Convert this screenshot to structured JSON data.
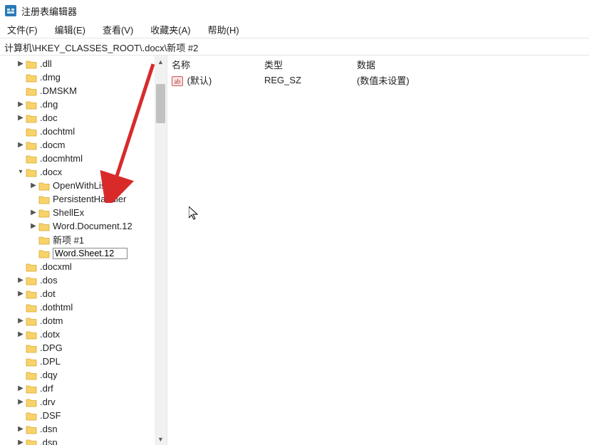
{
  "window": {
    "title": "注册表编辑器"
  },
  "menu": {
    "file": "文件(F)",
    "edit": "编辑(E)",
    "view": "查看(V)",
    "favorites": "收藏夹(A)",
    "help": "帮助(H)"
  },
  "address": "计算机\\HKEY_CLASSES_ROOT\\.docx\\新项 #2",
  "tree": [
    {
      "indent": 1,
      "exp": ">",
      "label": ".dll"
    },
    {
      "indent": 1,
      "exp": "",
      "label": ".dmg"
    },
    {
      "indent": 1,
      "exp": "",
      "label": ".DMSKM"
    },
    {
      "indent": 1,
      "exp": ">",
      "label": ".dng"
    },
    {
      "indent": 1,
      "exp": ">",
      "label": ".doc"
    },
    {
      "indent": 1,
      "exp": "",
      "label": ".dochtml"
    },
    {
      "indent": 1,
      "exp": ">",
      "label": ".docm"
    },
    {
      "indent": 1,
      "exp": "",
      "label": ".docmhtml"
    },
    {
      "indent": 1,
      "exp": "v",
      "label": ".docx"
    },
    {
      "indent": 2,
      "exp": ">",
      "label": "OpenWithList"
    },
    {
      "indent": 2,
      "exp": "",
      "label": "PersistentHandler"
    },
    {
      "indent": 2,
      "exp": ">",
      "label": "ShellEx"
    },
    {
      "indent": 2,
      "exp": ">",
      "label": "Word.Document.12"
    },
    {
      "indent": 2,
      "exp": "",
      "label": "新项 #1"
    },
    {
      "indent": 2,
      "exp": "",
      "label": "Word.Sheet.12",
      "editing": true
    },
    {
      "indent": 1,
      "exp": "",
      "label": ".docxml"
    },
    {
      "indent": 1,
      "exp": ">",
      "label": ".dos"
    },
    {
      "indent": 1,
      "exp": ">",
      "label": ".dot"
    },
    {
      "indent": 1,
      "exp": "",
      "label": ".dothtml"
    },
    {
      "indent": 1,
      "exp": ">",
      "label": ".dotm"
    },
    {
      "indent": 1,
      "exp": ">",
      "label": ".dotx"
    },
    {
      "indent": 1,
      "exp": "",
      "label": ".DPG"
    },
    {
      "indent": 1,
      "exp": "",
      "label": ".DPL"
    },
    {
      "indent": 1,
      "exp": "",
      "label": ".dqy"
    },
    {
      "indent": 1,
      "exp": ">",
      "label": ".drf"
    },
    {
      "indent": 1,
      "exp": ">",
      "label": ".drv"
    },
    {
      "indent": 1,
      "exp": "",
      "label": ".DSF"
    },
    {
      "indent": 1,
      "exp": ">",
      "label": ".dsn"
    },
    {
      "indent": 1,
      "exp": ">",
      "label": ".dsp"
    }
  ],
  "list": {
    "columns": {
      "name": "名称",
      "type": "类型",
      "data": "数据"
    },
    "rows": [
      {
        "name": "(默认)",
        "type": "REG_SZ",
        "data": "(数值未设置)"
      }
    ]
  },
  "icons": {
    "expand_right": "▶",
    "expand_down": "▾",
    "scroll_up": "▲",
    "scroll_down": "▼"
  },
  "colors": {
    "folder_fill": "#f8d26a",
    "folder_stroke": "#d9a82f",
    "arrow": "#d92a2a",
    "value_badge_border": "#d05a5a",
    "value_badge_fill": "#f8e0e0",
    "app_icon_fill": "#2a7ab8"
  }
}
